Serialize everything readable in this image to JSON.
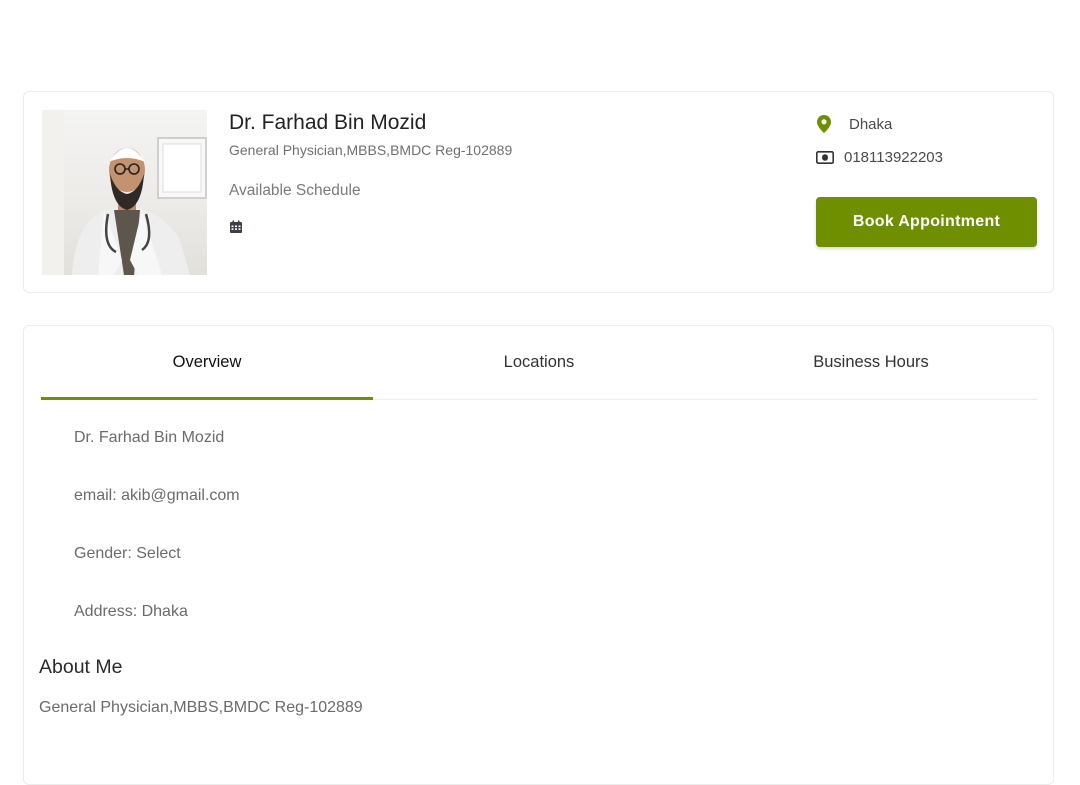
{
  "doctor": {
    "name": "Dr. Farhad Bin Mozid",
    "subtitle": "General Physician,MBBS,BMDC Reg-102889",
    "schedule_label": "Available Schedule",
    "location": "Dhaka",
    "phone": "018113922203"
  },
  "actions": {
    "book_label": "Book Appointment"
  },
  "tabs": [
    {
      "label": "Overview",
      "active": true
    },
    {
      "label": "Locations",
      "active": false
    },
    {
      "label": "Business Hours",
      "active": false
    }
  ],
  "overview": {
    "name": "Dr. Farhad Bin Mozid",
    "email": "email: akib@gmail.com",
    "gender": "Gender: Select",
    "address": "Address: Dhaka"
  },
  "about": {
    "title": "About Me",
    "text": "General Physician,MBBS,BMDC Reg-102889"
  },
  "icons": {
    "location": "map-pin-icon",
    "phone": "money-bill-icon",
    "schedule": "calendar-icon"
  },
  "colors": {
    "accent": "#6f8f00",
    "pin": "#6f8f00"
  }
}
